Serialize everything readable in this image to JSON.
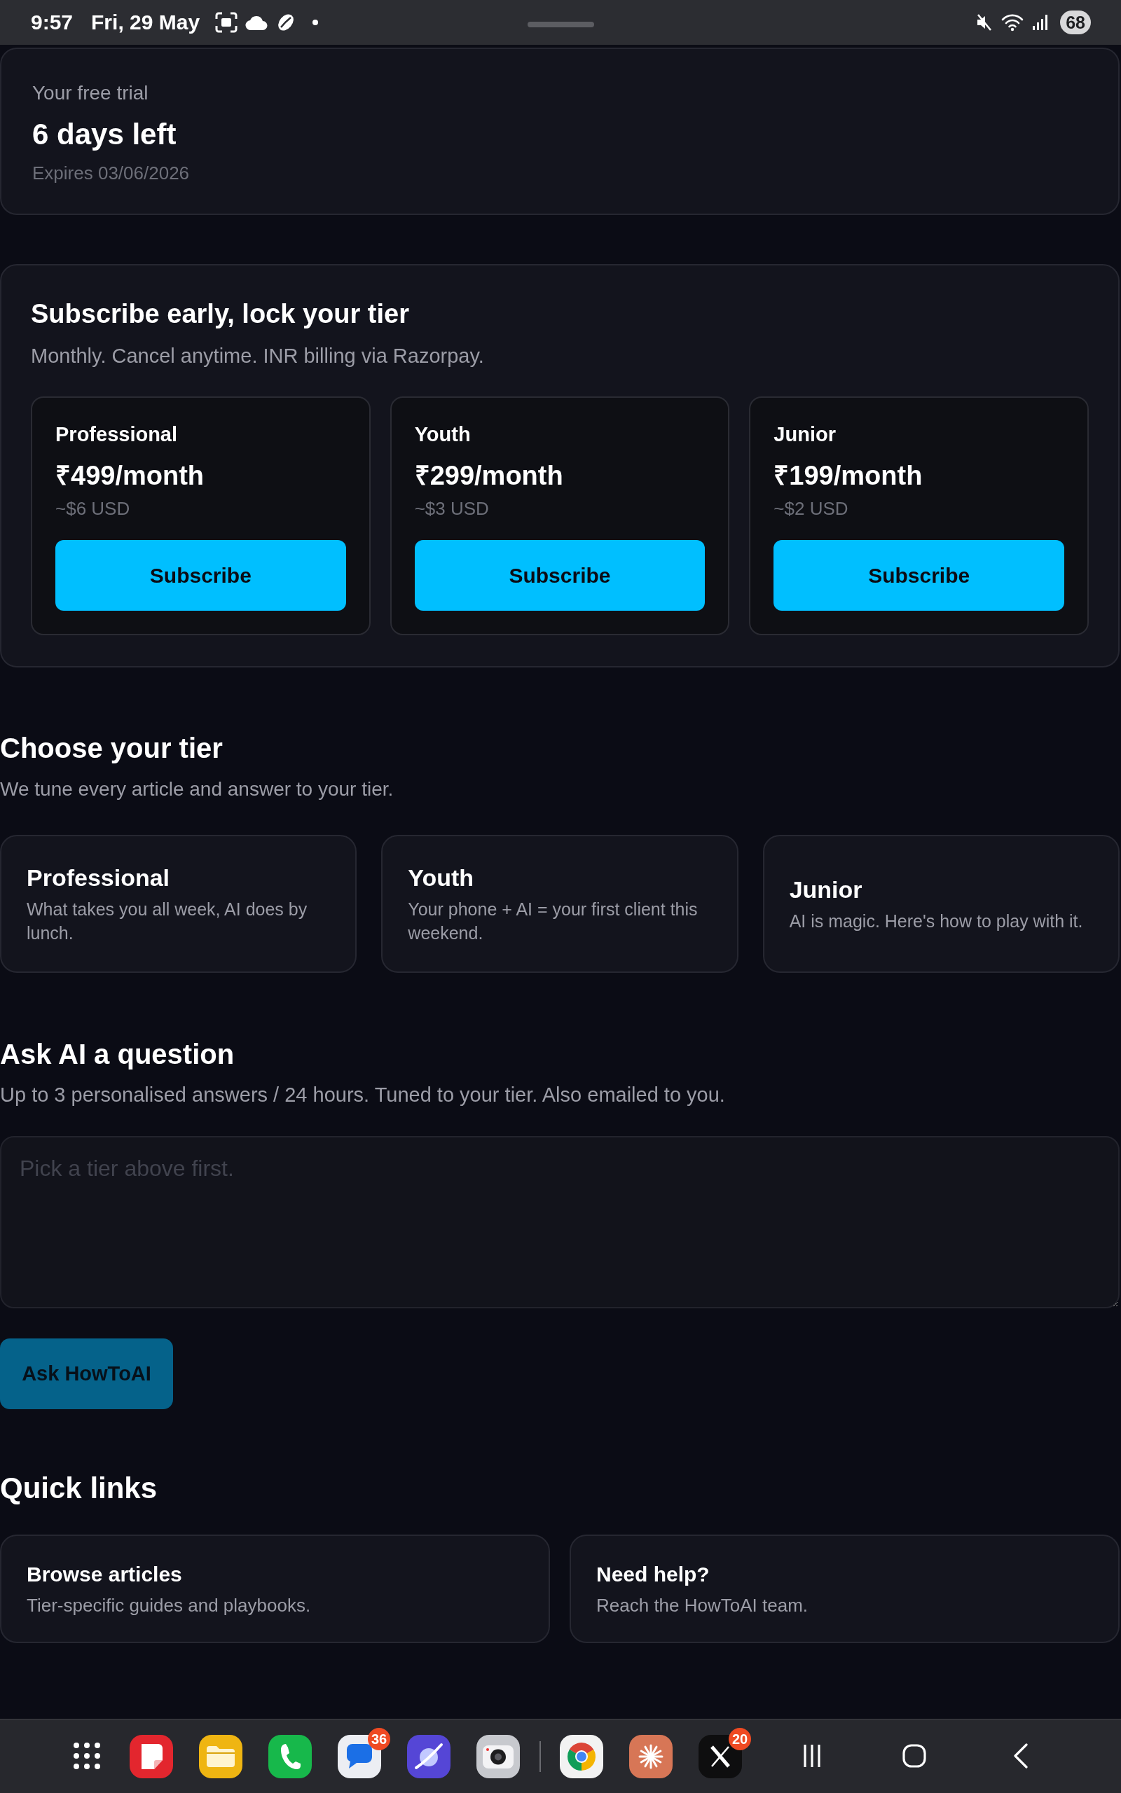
{
  "status_bar": {
    "time": "9:57",
    "date": "Fri, 29 May",
    "battery": "68"
  },
  "trial": {
    "label": "Your free trial",
    "days_left": "6 days left",
    "expires": "Expires 03/06/2026"
  },
  "subscribe": {
    "title": "Subscribe early, lock your tier",
    "subtitle": "Monthly. Cancel anytime. INR billing via Razorpay.",
    "plans": [
      {
        "name": "Professional",
        "price": "₹499/month",
        "usd": "~$6 USD",
        "button": "Subscribe"
      },
      {
        "name": "Youth",
        "price": "₹299/month",
        "usd": "~$3 USD",
        "button": "Subscribe"
      },
      {
        "name": "Junior",
        "price": "₹199/month",
        "usd": "~$2 USD",
        "button": "Subscribe"
      }
    ]
  },
  "tiers": {
    "title": "Choose your tier",
    "subtitle": "We tune every article and answer to your tier.",
    "items": [
      {
        "name": "Professional",
        "description": "What takes you all week, AI does by lunch.",
        "selected": false
      },
      {
        "name": "Youth",
        "description": "Your phone + AI = your first client this weekend.",
        "selected": false
      },
      {
        "name": "Junior",
        "description": "AI is magic. Here's how to play with it.",
        "selected": false
      }
    ]
  },
  "ask": {
    "title": "Ask AI a question",
    "subtitle": "Up to 3 personalised answers / 24 hours. Tuned to your tier. Also emailed to you.",
    "placeholder": "Pick a tier above first.",
    "button": {
      "label": "Ask HowToAI",
      "disabled": true
    }
  },
  "quick_links": {
    "title": "Quick links",
    "items": [
      {
        "title": "Browse articles",
        "description": "Tier-specific guides and playbooks."
      },
      {
        "title": "Need help?",
        "description": "Reach the HowToAI team."
      }
    ]
  },
  "dock": {
    "pinned": [
      {
        "kind": "notebook"
      },
      {
        "kind": "folder"
      },
      {
        "kind": "phone"
      },
      {
        "kind": "chat",
        "badge": "36"
      },
      {
        "kind": "planet"
      },
      {
        "kind": "camera"
      }
    ],
    "recent": [
      {
        "kind": "ring"
      },
      {
        "kind": "sunburst"
      },
      {
        "kind": "x",
        "badge": "20"
      }
    ]
  }
}
